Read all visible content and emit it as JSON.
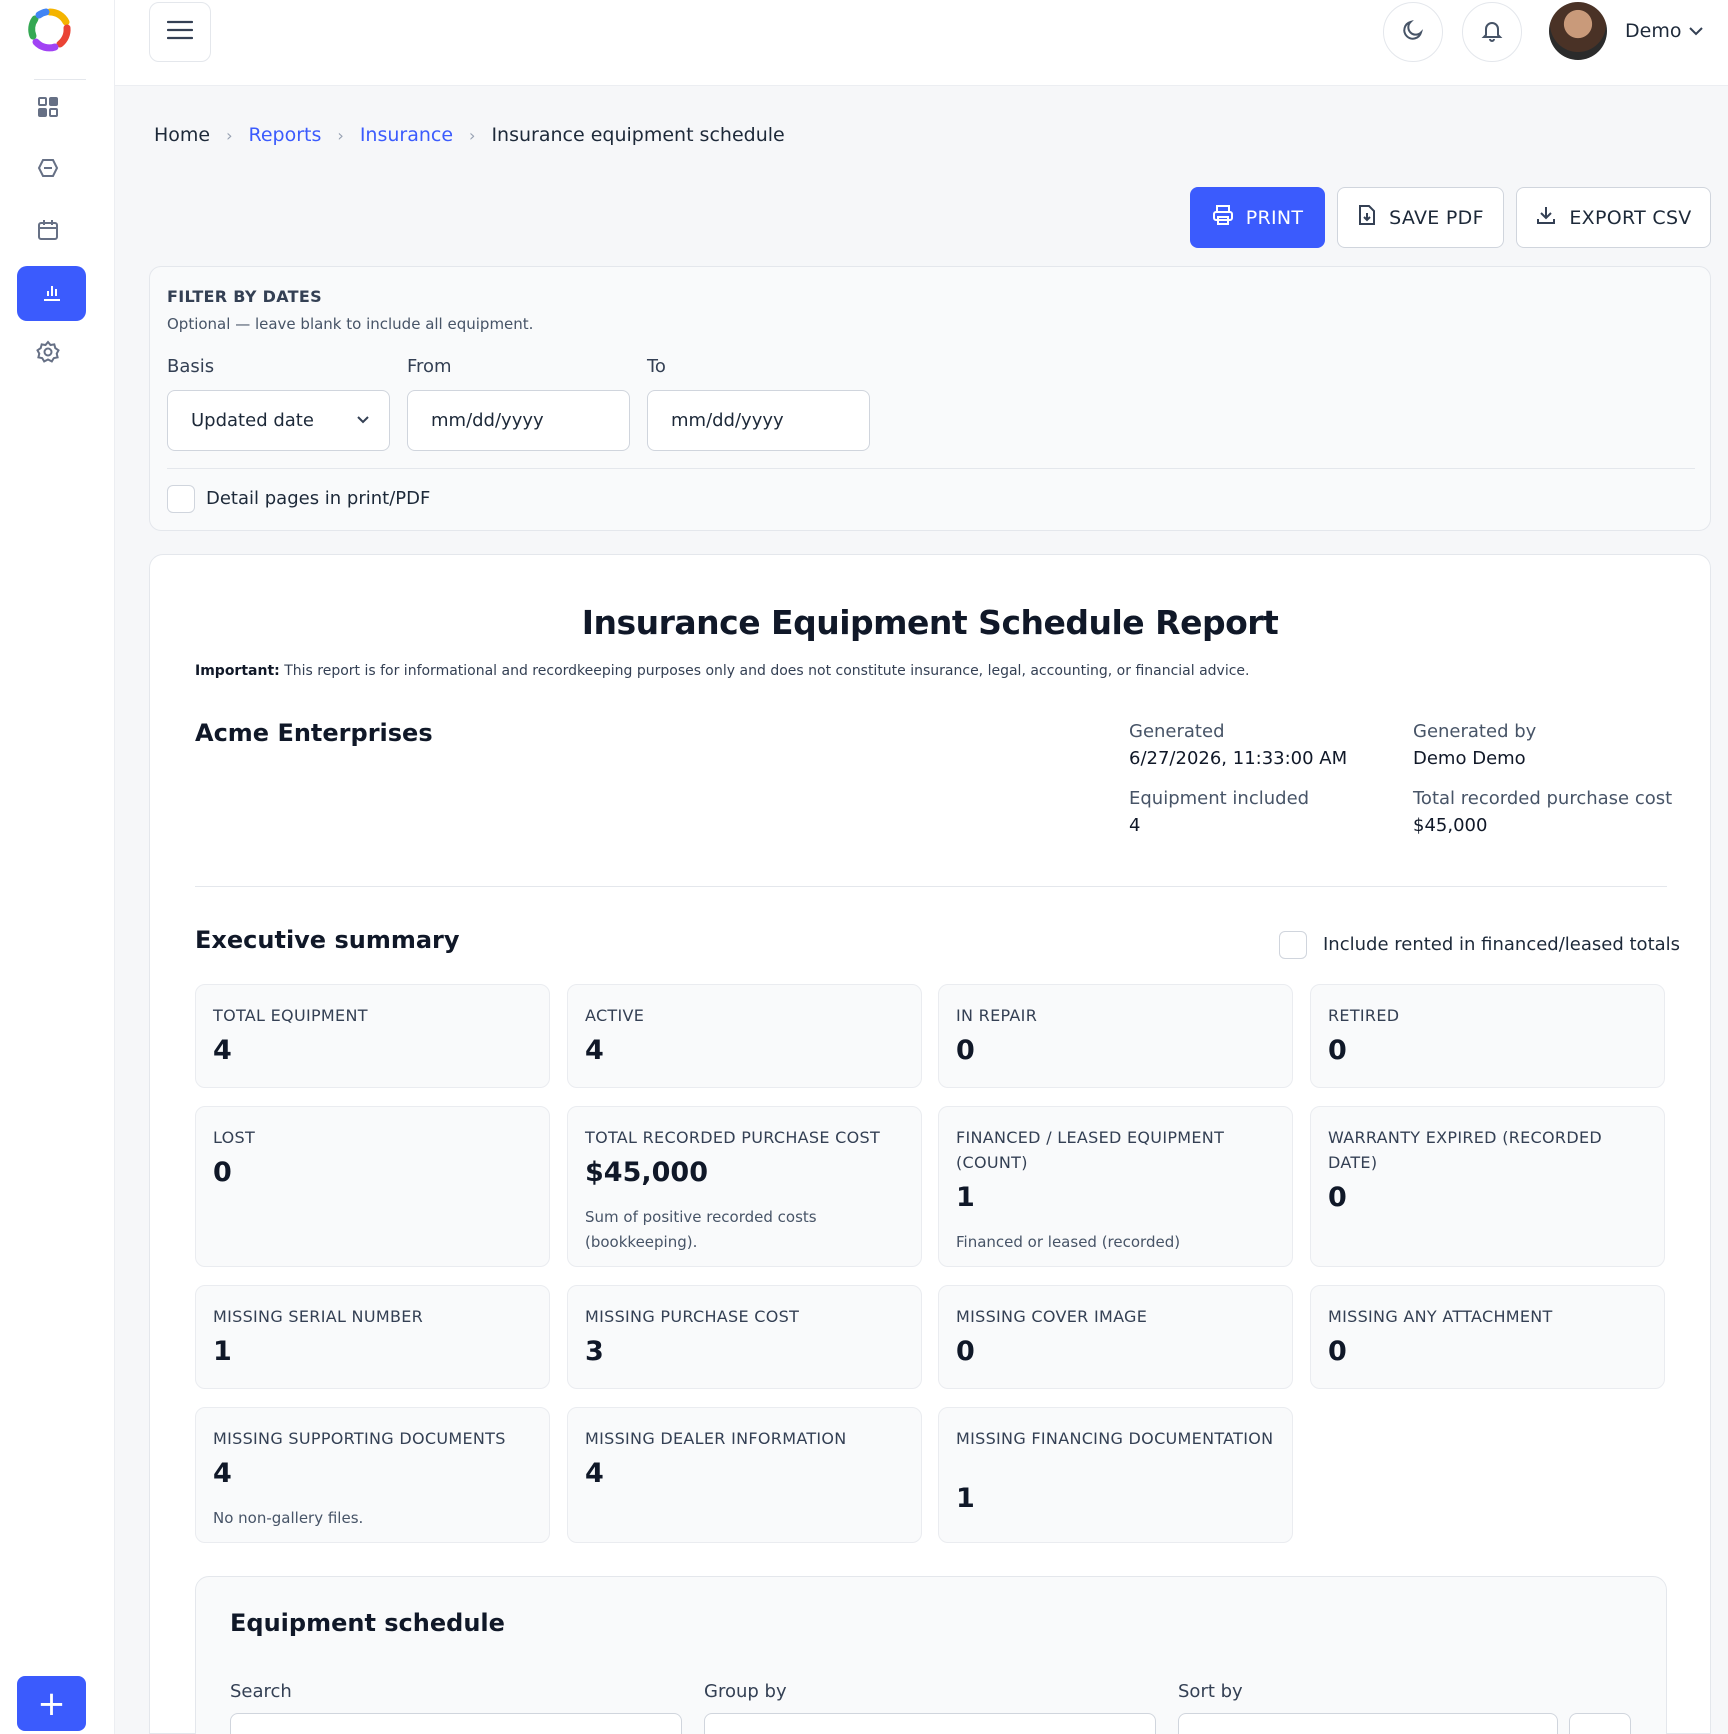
{
  "sidebar": {
    "items": [
      {
        "icon": "dashboard-icon"
      },
      {
        "icon": "tag-icon"
      },
      {
        "icon": "calendar-icon"
      },
      {
        "icon": "reports-icon",
        "active": true
      },
      {
        "icon": "settings-icon"
      }
    ],
    "add_label": "+"
  },
  "topbar": {
    "user_name": "Demo"
  },
  "breadcrumb": {
    "home": "Home",
    "reports": "Reports",
    "insurance": "Insurance",
    "current": "Insurance equipment schedule",
    "separator": "›"
  },
  "actions": {
    "print": "PRINT",
    "save_pdf": "SAVE PDF",
    "export_csv": "EXPORT CSV"
  },
  "filter": {
    "title": "FILTER BY DATES",
    "subtitle": "Optional — leave blank to include all equipment.",
    "basis_label": "Basis",
    "basis_value": "Updated date",
    "from_label": "From",
    "from_placeholder": "mm/dd/yyyy",
    "to_label": "To",
    "to_placeholder": "mm/dd/yyyy",
    "detail_pages_label": "Detail pages in print/PDF"
  },
  "report": {
    "title": "Insurance Equipment Schedule Report",
    "important_label": "Important:",
    "important_text": " This report is for informational and recordkeeping purposes only and does not constitute insurance, legal, accounting, or financial advice.",
    "company": "Acme Enterprises",
    "generated_label": "Generated",
    "generated_value": "6/27/2026, 11:33:00 AM",
    "generated_by_label": "Generated by",
    "generated_by_value": "Demo Demo",
    "equipment_included_label": "Equipment included",
    "equipment_included_value": "4",
    "total_cost_label": "Total recorded purchase cost",
    "total_cost_value": "$45,000"
  },
  "summary": {
    "title": "Executive summary",
    "include_rented_label": "Include rented in financed/leased totals",
    "stats": [
      {
        "label": "TOTAL EQUIPMENT",
        "value": "4"
      },
      {
        "label": "ACTIVE",
        "value": "4"
      },
      {
        "label": "IN REPAIR",
        "value": "0"
      },
      {
        "label": "RETIRED",
        "value": "0"
      },
      {
        "label": "LOST",
        "value": "0"
      },
      {
        "label": "TOTAL RECORDED PURCHASE COST",
        "value": "$45,000",
        "note": "Sum of positive recorded costs (bookkeeping)."
      },
      {
        "label": "FINANCED / LEASED EQUIPMENT (COUNT)",
        "value": "1",
        "note": "Financed or leased (recorded)"
      },
      {
        "label": "WARRANTY EXPIRED (RECORDED DATE)",
        "value": "0"
      },
      {
        "label": "MISSING SERIAL NUMBER",
        "value": "1"
      },
      {
        "label": "MISSING PURCHASE COST",
        "value": "3"
      },
      {
        "label": "MISSING COVER IMAGE",
        "value": "0"
      },
      {
        "label": "MISSING ANY ATTACHMENT",
        "value": "0"
      },
      {
        "label": "MISSING SUPPORTING DOCUMENTS",
        "value": "4",
        "note": "No non-gallery files."
      },
      {
        "label": "MISSING DEALER INFORMATION",
        "value": "4"
      },
      {
        "label": "MISSING FINANCING DOCUMENTATION",
        "value": "1"
      }
    ]
  },
  "schedule": {
    "title": "Equipment schedule",
    "search_label": "Search",
    "group_by_label": "Group by",
    "sort_by_label": "Sort by"
  },
  "colors": {
    "accent": "#3b5bfd"
  }
}
